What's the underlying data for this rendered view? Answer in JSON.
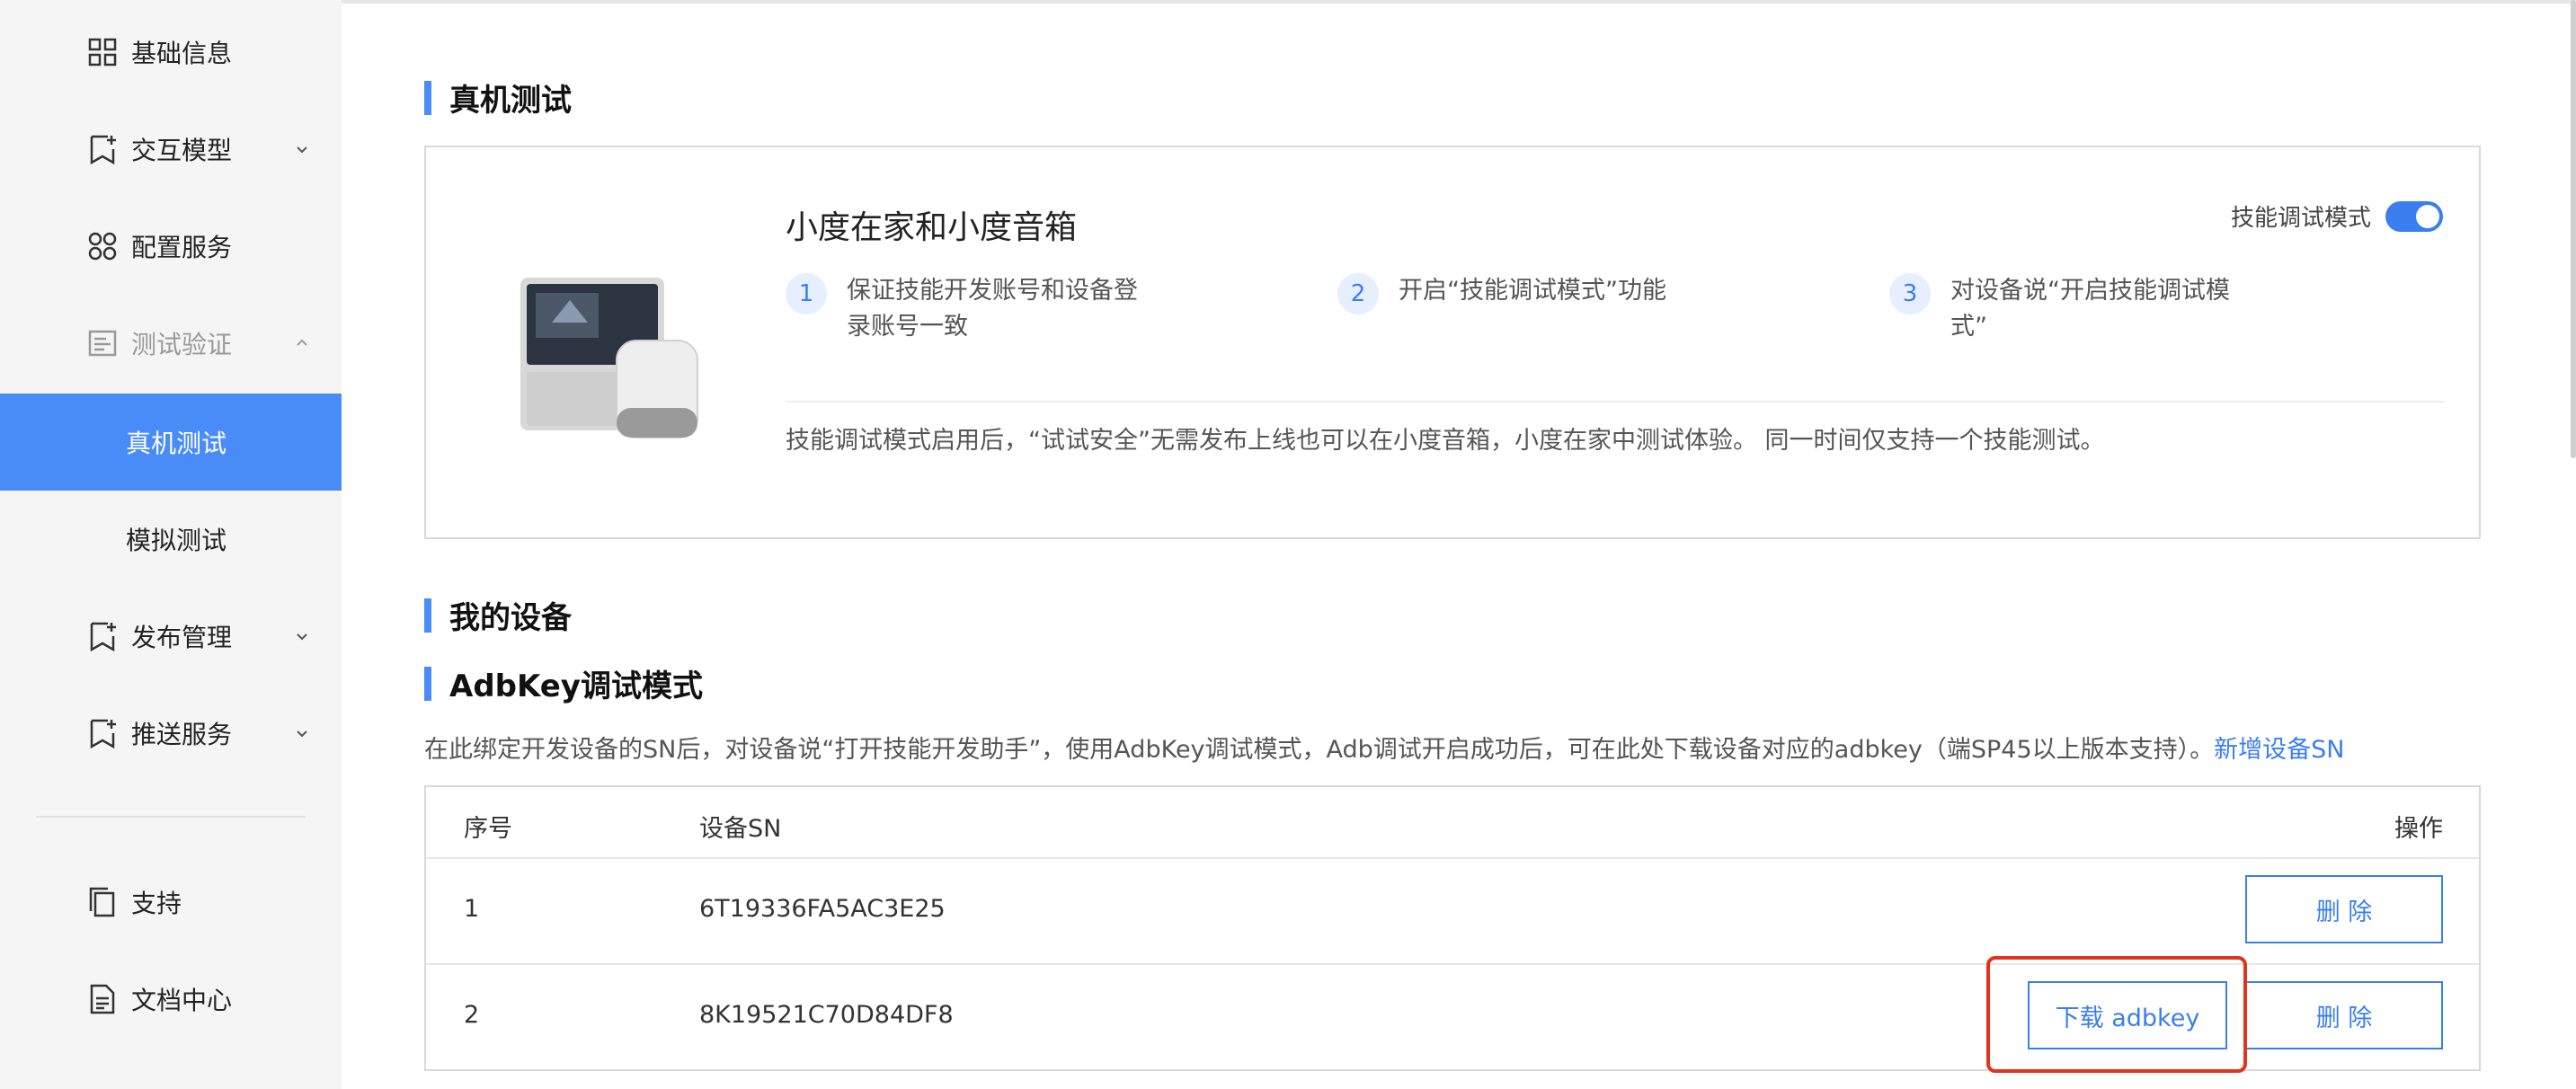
{
  "sidebar": {
    "items": [
      {
        "label": "基础信息"
      },
      {
        "label": "交互模型"
      },
      {
        "label": "配置服务"
      },
      {
        "label": "测试验证"
      },
      {
        "label": "真机测试"
      },
      {
        "label": "模拟测试"
      },
      {
        "label": "发布管理"
      },
      {
        "label": "推送服务"
      },
      {
        "label": "支持"
      },
      {
        "label": "文档中心"
      }
    ],
    "active_color": "#4a8cf7"
  },
  "sections": {
    "real_device_test": "真机测试",
    "my_devices": "我的设备",
    "adbkey_mode": "AdbKey调试模式"
  },
  "card": {
    "title": "小度在家和小度音箱",
    "toggle_label": "技能调试模式",
    "toggle_on": true,
    "steps": [
      {
        "num": "1",
        "text": "保证技能开发账号和设备登录账号一致"
      },
      {
        "num": "2",
        "text": "开启“技能调试模式”功能"
      },
      {
        "num": "3",
        "text": "对设备说“开启技能调试模式”"
      }
    ],
    "note": "技能调试模式启用后，“试试安全”无需发布上线也可以在小度音箱，小度在家中测试体验。 同一时间仅支持一个技能测试。"
  },
  "adbkey": {
    "description": "在此绑定开发设备的SN后，对设备说“打开技能开发助手”，使用AdbKey调试模式，Adb调试开启成功后，可在此处下载设备对应的adbkey（端SP45以上版本支持）。",
    "add_link": "新增设备SN"
  },
  "table": {
    "headers": {
      "index": "序号",
      "sn": "设备SN",
      "ops": "操作"
    },
    "rows": [
      {
        "index": "1",
        "sn": "6T19336FA5AC3E25"
      },
      {
        "index": "2",
        "sn": "8K19521C70D84DF8"
      }
    ],
    "delete_label": "删 除",
    "download_label": "下载 adbkey"
  },
  "colors": {
    "accent": "#3a7ef0",
    "highlight": "#e0341c"
  }
}
